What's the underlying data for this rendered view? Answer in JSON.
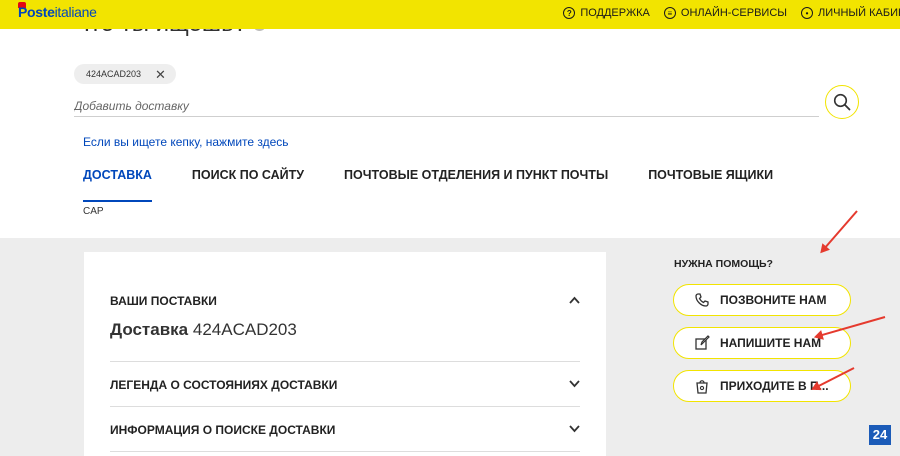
{
  "header": {
    "logo_bold": "Poste",
    "logo_rest": "italiane",
    "links": [
      {
        "label": "ПОДДЕРЖКА",
        "icon": "question-circle-icon"
      },
      {
        "label": "ОНЛАЙН-СЕРВИСЫ",
        "icon": "list-circle-icon"
      },
      {
        "label": "ЛИЧНЫЙ КАБИНЕТ",
        "icon": "user-circle-icon"
      }
    ]
  },
  "search": {
    "title": "Что ты ищешь?",
    "chip": "424ACAD203",
    "placeholder": "Добавить доставку"
  },
  "cap_link": "Если вы ищете кепку, нажмите здесь",
  "tabs": [
    {
      "label": "ДОСТАВКА",
      "active": true
    },
    {
      "label": "ПОИСК ПО САЙТУ",
      "active": false
    },
    {
      "label": "ПОЧТОВЫЕ ОТДЕЛЕНИЯ И ПУНКТ ПОЧТЫ",
      "active": false
    },
    {
      "label": "ПОЧТОВЫЕ ЯЩИКИ",
      "active": false
    }
  ],
  "cap_sub": "CAP",
  "card": {
    "section1": "ВАШИ ПОСТАВКИ",
    "delivery_label": "Доставка",
    "delivery_code": "424ACAD203",
    "section2": "ЛЕГЕНДА О СОСТОЯНИЯХ ДОСТАВКИ",
    "section3": "ИНФОРМАЦИЯ О ПОИСКЕ ДОСТАВКИ"
  },
  "help": {
    "title": "НУЖНА ПОМОЩЬ?",
    "call": "ПОЗВОНИТЕ НАМ",
    "write": "НАПИШИТЕ НАМ",
    "visit": "ПРИХОДИТЕ В П..."
  },
  "badge": "24",
  "colors": {
    "brand_yellow": "#f2e400",
    "brand_blue": "#0047bb",
    "annotation_red": "#e53a2e"
  }
}
